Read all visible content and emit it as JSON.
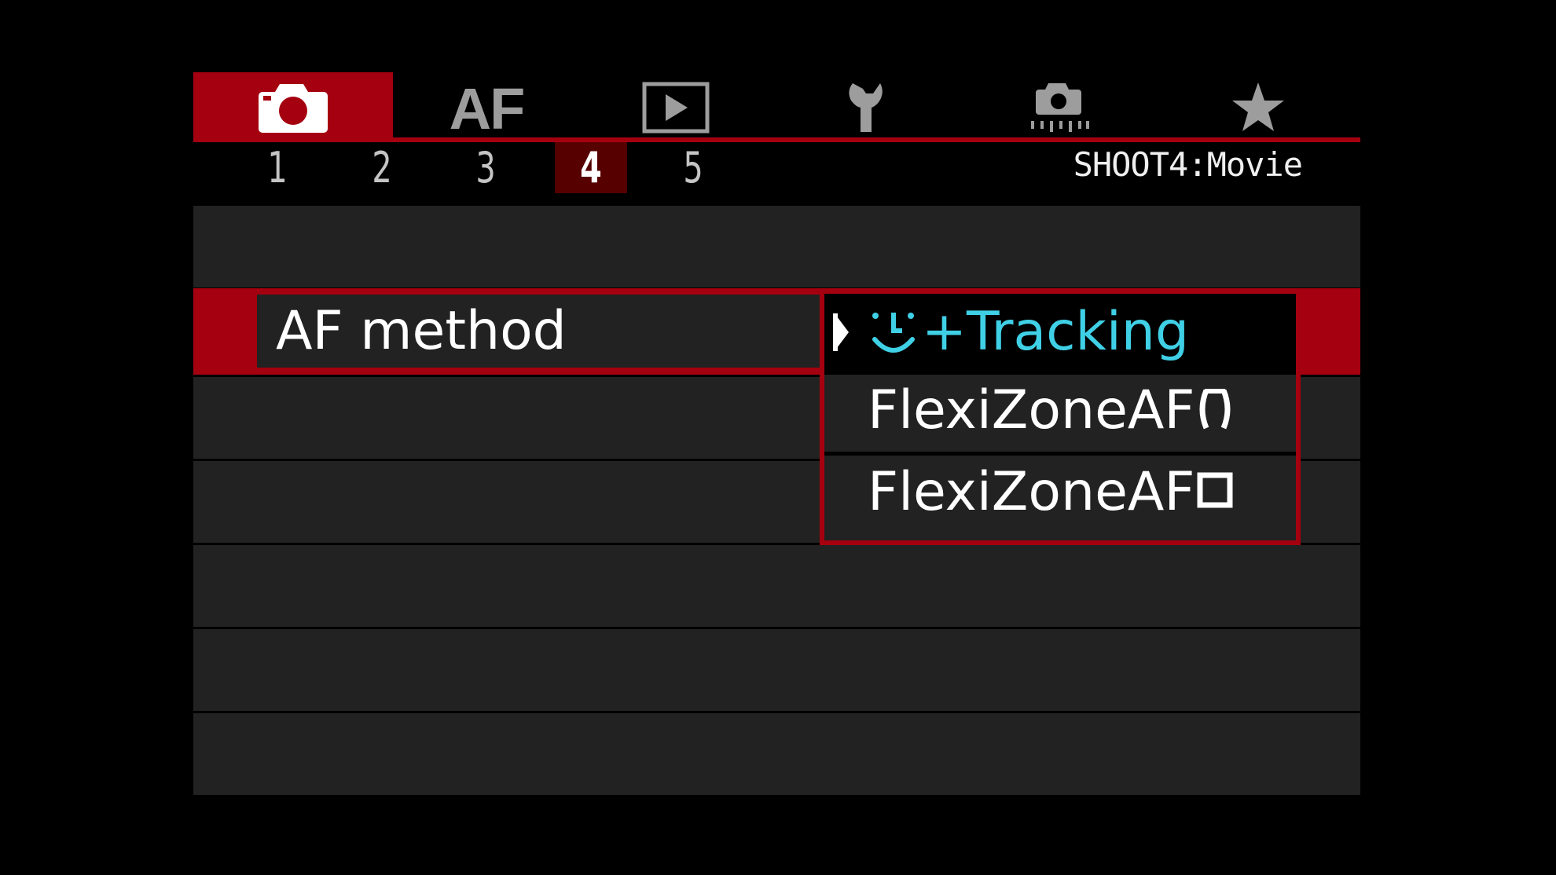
{
  "tabs": [
    {
      "name": "shooting",
      "icon": "camera-icon",
      "active": true
    },
    {
      "name": "af",
      "label": "AF",
      "active": false
    },
    {
      "name": "playback",
      "icon": "playback-icon",
      "active": false
    },
    {
      "name": "setup",
      "icon": "wrench-icon",
      "active": false
    },
    {
      "name": "custom-functions",
      "icon": "camera-custom-icon",
      "active": false
    },
    {
      "name": "my-menu",
      "icon": "star-icon",
      "active": false
    }
  ],
  "pages": [
    "1",
    "2",
    "3",
    "4",
    "5"
  ],
  "active_page": "4",
  "page_title": "SHOOT4:Movie",
  "item": {
    "label": "AF method"
  },
  "dropdown": {
    "options": [
      {
        "label": "+Tracking",
        "icon": "face-tracking-icon",
        "selected": true
      },
      {
        "label": "FlexiZoneAF",
        "icon": "bracket-frame-icon",
        "selected": false
      },
      {
        "label": "FlexiZoneAF",
        "icon": "square-frame-icon",
        "selected": false
      }
    ]
  },
  "colors": {
    "accent": "#a5000f",
    "active_page_bg": "#560000",
    "row_bg": "#222222",
    "selected_text": "#3fd0e6",
    "inactive_icon": "#9d9d9d"
  }
}
